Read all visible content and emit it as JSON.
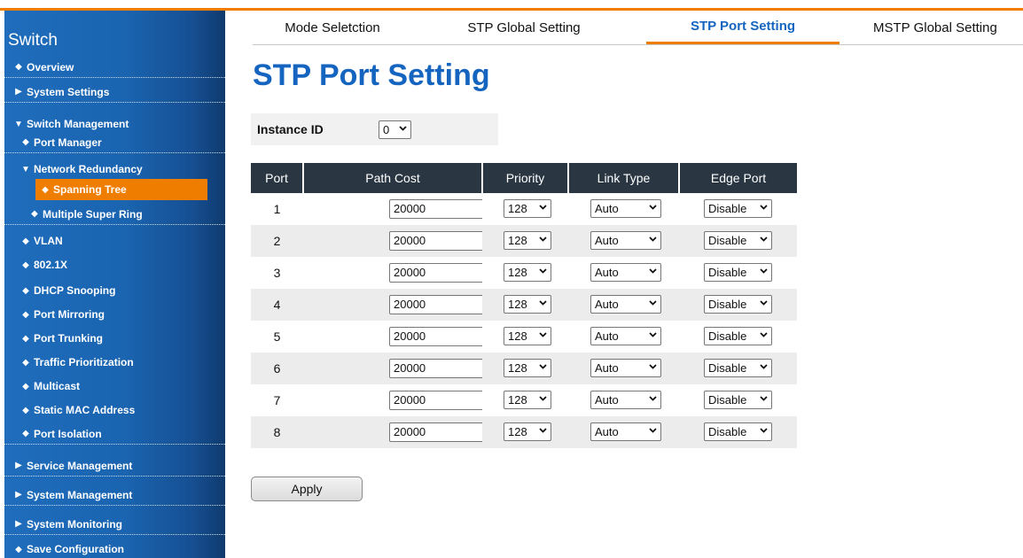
{
  "sidebar": {
    "brand": "Switch",
    "items": [
      {
        "label": "Overview",
        "marker": "◆"
      },
      {
        "label": "System Settings",
        "marker": "▶"
      },
      {
        "label": "Switch Management",
        "marker": "▼"
      },
      {
        "label": "Port Manager",
        "marker": "◆"
      },
      {
        "label": "Network Redundancy",
        "marker": "▼"
      },
      {
        "label": "Spanning Tree",
        "marker": "◆",
        "active": true
      },
      {
        "label": "Multiple Super Ring",
        "marker": "◆"
      },
      {
        "label": "VLAN",
        "marker": "◆"
      },
      {
        "label": "802.1X",
        "marker": "◆"
      },
      {
        "label": "DHCP Snooping",
        "marker": "◆"
      },
      {
        "label": "Port Mirroring",
        "marker": "◆"
      },
      {
        "label": "Port Trunking",
        "marker": "◆"
      },
      {
        "label": "Traffic Prioritization",
        "marker": "◆"
      },
      {
        "label": "Multicast",
        "marker": "◆"
      },
      {
        "label": "Static MAC Address",
        "marker": "◆"
      },
      {
        "label": "Port Isolation",
        "marker": "◆"
      },
      {
        "label": "Service Management",
        "marker": "▶"
      },
      {
        "label": "System Management",
        "marker": "▶"
      },
      {
        "label": "System Monitoring",
        "marker": "▶"
      },
      {
        "label": "Save Configuration",
        "marker": "◆"
      }
    ]
  },
  "tabs": [
    {
      "label": "Mode Seletction"
    },
    {
      "label": "STP Global Setting"
    },
    {
      "label": "STP Port Setting",
      "active": true
    },
    {
      "label": "MSTP Global Setting"
    }
  ],
  "page_title": "STP Port Setting",
  "instance": {
    "label": "Instance ID",
    "value": "0"
  },
  "table": {
    "headers": [
      "Port",
      "Path Cost",
      "Priority",
      "Link Type",
      "Edge Port"
    ],
    "rows": [
      {
        "port": "1",
        "path_cost": "20000",
        "priority": "128",
        "link_type": "Auto",
        "edge_port": "Disable"
      },
      {
        "port": "2",
        "path_cost": "20000",
        "priority": "128",
        "link_type": "Auto",
        "edge_port": "Disable"
      },
      {
        "port": "3",
        "path_cost": "20000",
        "priority": "128",
        "link_type": "Auto",
        "edge_port": "Disable"
      },
      {
        "port": "4",
        "path_cost": "20000",
        "priority": "128",
        "link_type": "Auto",
        "edge_port": "Disable"
      },
      {
        "port": "5",
        "path_cost": "20000",
        "priority": "128",
        "link_type": "Auto",
        "edge_port": "Disable"
      },
      {
        "port": "6",
        "path_cost": "20000",
        "priority": "128",
        "link_type": "Auto",
        "edge_port": "Disable"
      },
      {
        "port": "7",
        "path_cost": "20000",
        "priority": "128",
        "link_type": "Auto",
        "edge_port": "Disable"
      },
      {
        "port": "8",
        "path_cost": "20000",
        "priority": "128",
        "link_type": "Auto",
        "edge_port": "Disable"
      }
    ]
  },
  "apply_label": "Apply",
  "colors": {
    "accent": "#ee7d00",
    "title_blue": "#1565c0",
    "header_dark": "#2a3743",
    "sidebar_blue": "#1a64b0"
  }
}
